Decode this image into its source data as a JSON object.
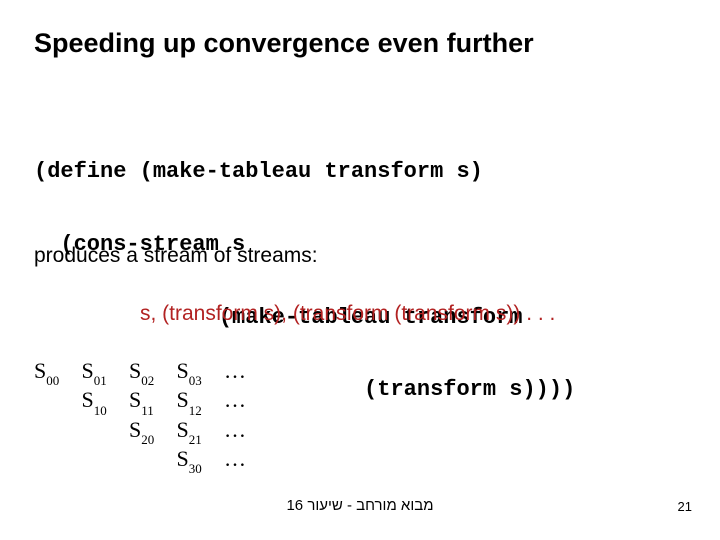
{
  "title": "Speeding up convergence even further",
  "code": {
    "l1": "(define (make-tableau transform s)",
    "l2": "  (cons-stream s",
    "l3": "              (make-tableau transform",
    "l4": "                         (transform s))))"
  },
  "produces": "produces a stream of streams:",
  "stream": "s, (transform s), (transform (transform s)) . . .",
  "matrix": {
    "r0": {
      "c0": "00",
      "c1": "01",
      "c2": "02",
      "c3": "03"
    },
    "r1": {
      "c1": "10",
      "c2": "11",
      "c3": "12"
    },
    "r2": {
      "c2": "20",
      "c3": "21"
    },
    "r3": {
      "c3": "30"
    },
    "dots": "…"
  },
  "footer": "מבוא מורחב - שיעור 16",
  "page": "21"
}
